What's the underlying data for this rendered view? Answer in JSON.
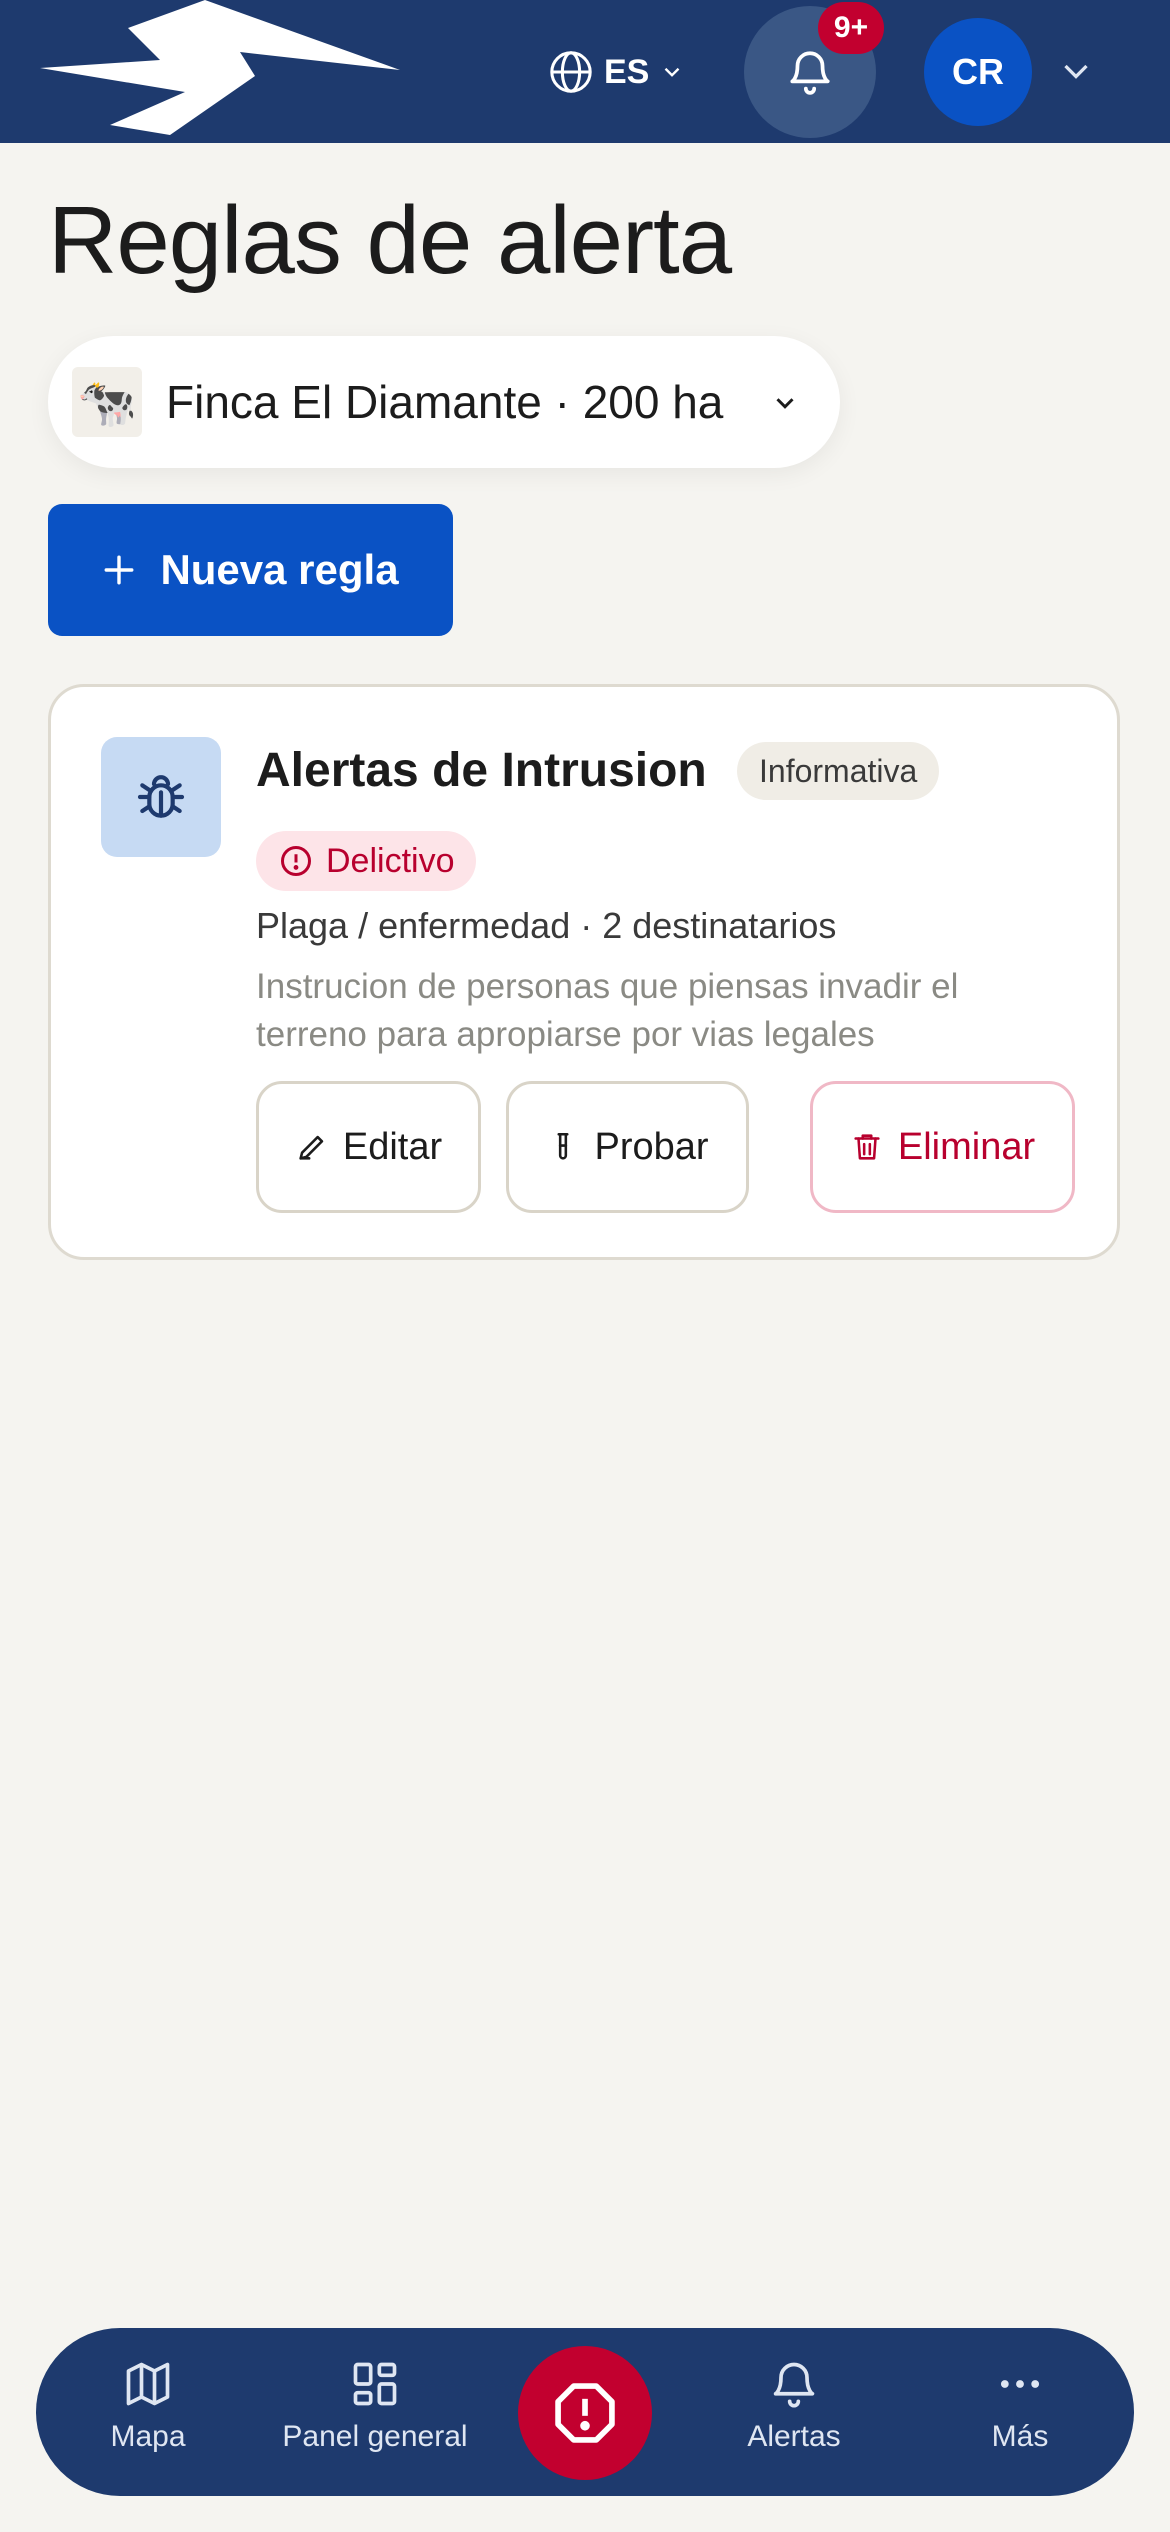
{
  "header": {
    "language": "ES",
    "notification_badge": "9+",
    "user_initials": "CR"
  },
  "page": {
    "title": "Reglas de alerta"
  },
  "farm_selector": {
    "icon": "🐄",
    "label": "Finca El Diamante · 200 ha"
  },
  "actions": {
    "new_rule": "Nueva regla"
  },
  "rules": [
    {
      "icon": "bug-icon",
      "title": "Alertas de Intrusion",
      "level": "Informativa",
      "category": "Delictivo",
      "meta": "Plaga / enfermedad · 2 destinatarios",
      "description": "Instrucion de personas que piensas invadir el terreno para apropiarse por vias legales",
      "buttons": {
        "edit": "Editar",
        "test": "Probar",
        "delete": "Eliminar"
      }
    }
  ],
  "bottom_nav": {
    "items": [
      {
        "label": "Mapa",
        "icon": "map-icon"
      },
      {
        "label": "Panel general",
        "icon": "dashboard-icon"
      },
      {
        "label": "Alertas",
        "icon": "bell-icon"
      },
      {
        "label": "Más",
        "icon": "more-icon"
      }
    ]
  },
  "colors": {
    "header_bg": "#1e3a6e",
    "primary": "#0a52c4",
    "danger": "#c2002f",
    "background": "#f5f4f0"
  }
}
